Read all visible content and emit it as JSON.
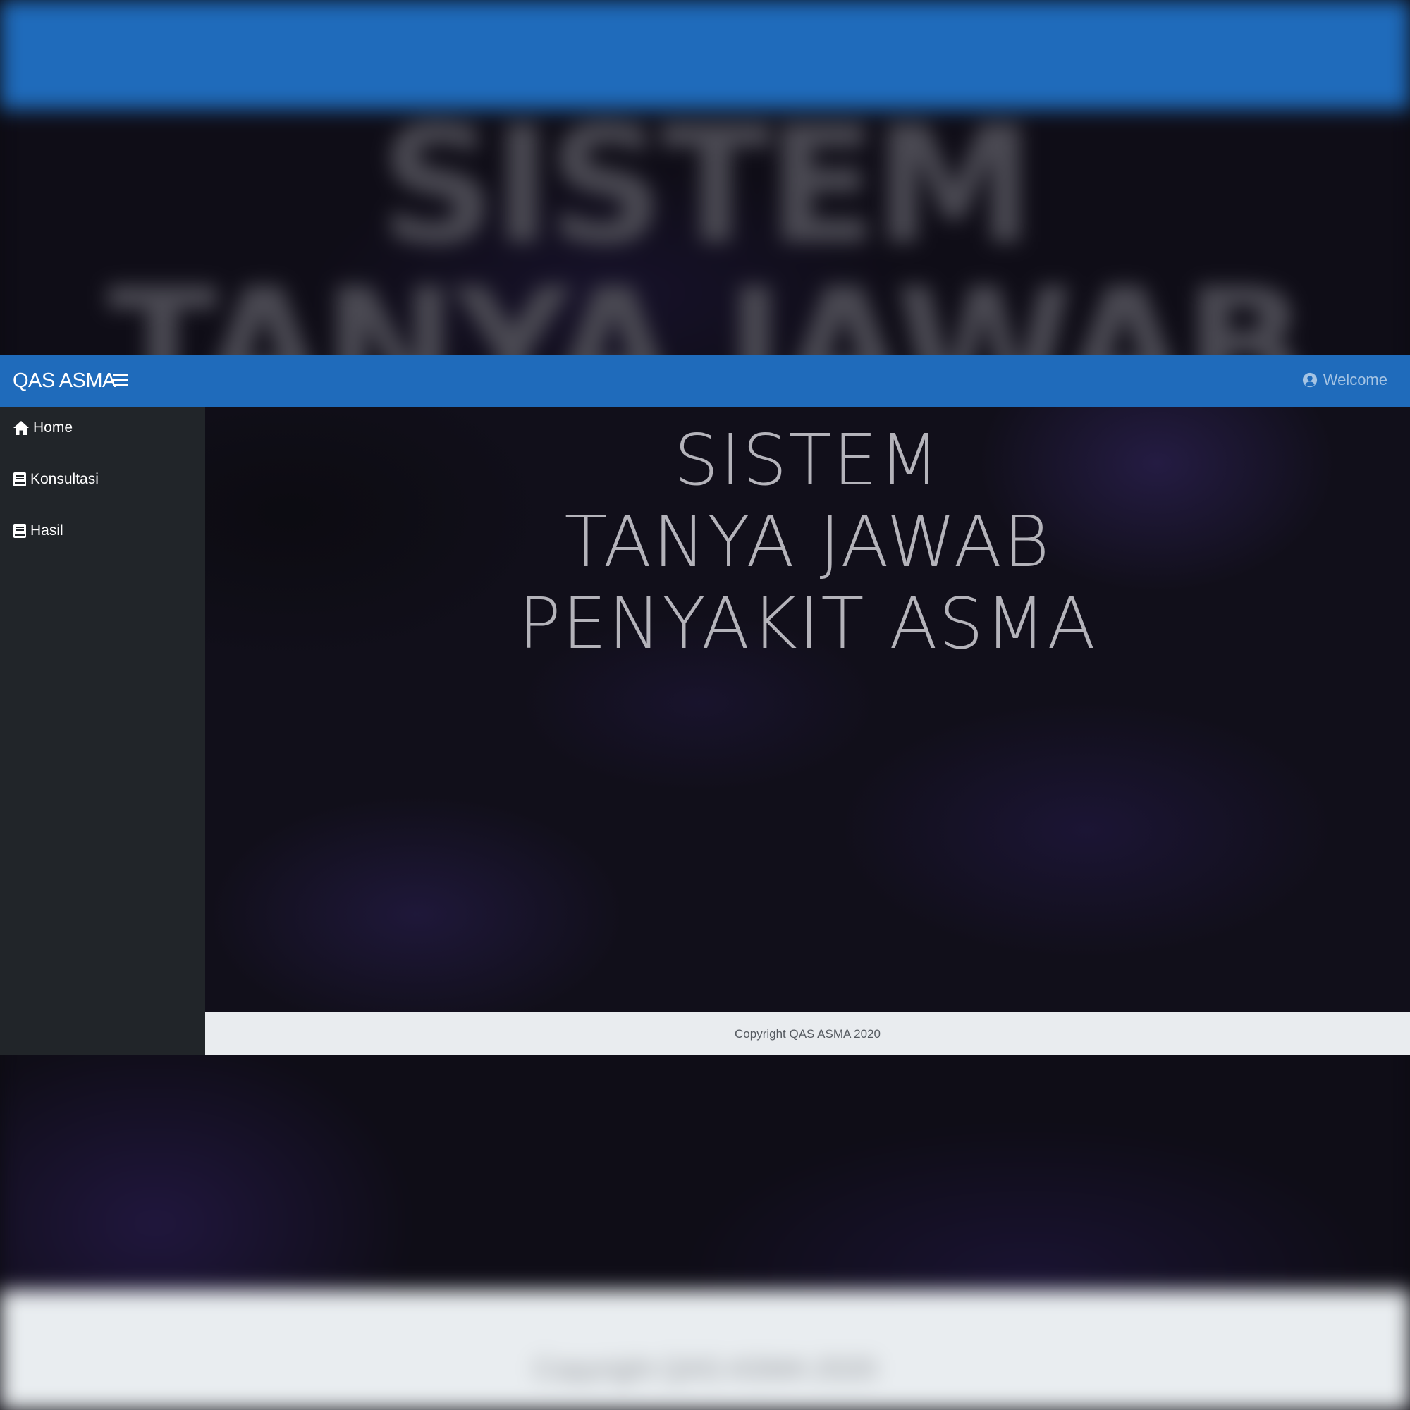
{
  "app": {
    "brand": "QAS ASMA",
    "welcome_label": "Welcome"
  },
  "sidebar": {
    "items": [
      {
        "label": "Home",
        "icon": "home-icon"
      },
      {
        "label": "Konsultasi",
        "icon": "book-icon"
      },
      {
        "label": "Hasil",
        "icon": "book-icon"
      }
    ]
  },
  "hero": {
    "line1": "SISTEM",
    "line2": "TANYA JAWAB",
    "line3": "PENYAKIT ASMA"
  },
  "footer": {
    "copyright": "Copyright QAS ASMA 2020"
  },
  "colors": {
    "topbar": "#1f6bbb",
    "sidebar": "#212529",
    "footer": "#e9ecef",
    "hero_text": "#b4b3ba"
  }
}
